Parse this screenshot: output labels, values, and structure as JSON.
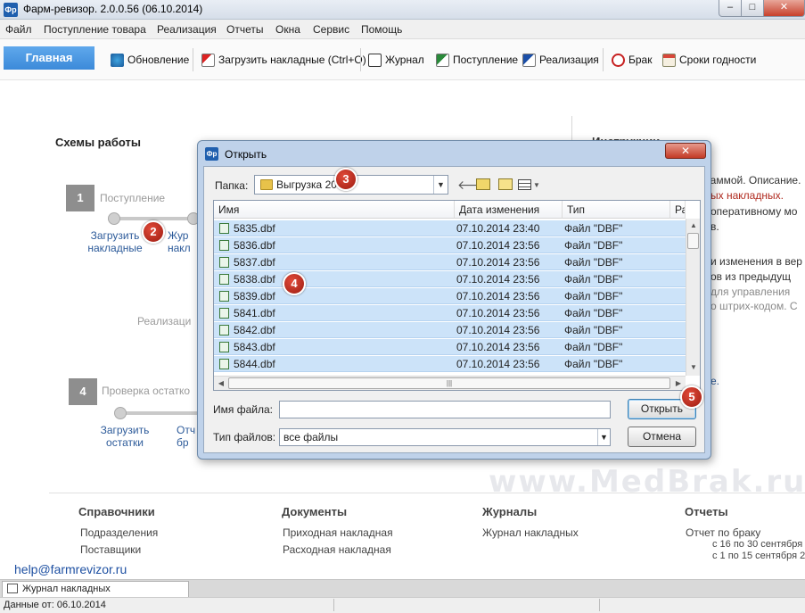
{
  "window": {
    "title": "Фарм-ревизор. 2.0.0.56 (06.10.2014)",
    "app_icon": "Фр",
    "min": "–",
    "max": "□",
    "close": "✕"
  },
  "menu": [
    "Файл",
    "Поступление товара",
    "Реализация",
    "Отчеты",
    "Окна",
    "Сервис",
    "Помощь"
  ],
  "toolbar": {
    "home": "Главная",
    "buttons": [
      "Обновление",
      "Загрузить накладные (Ctrl+O)",
      "Журнал",
      "Поступление",
      "Реализация",
      "Брак",
      "Сроки годности"
    ]
  },
  "schemes": {
    "title": "Схемы работы",
    "step1_num": "1",
    "step1_label": "Поступление",
    "step1_link1": "Загрузить\nнакладные",
    "step1_link2": "Жур\nнакл",
    "realization_label": "Реализаци",
    "step4_num": "4",
    "step4_label": "Проверка остатко",
    "step4_link1": "Загрузить\nостатки",
    "step4_link2": "Отч\nбр"
  },
  "instructions": {
    "title": "Инструкции",
    "line1": "раммой. Описание.",
    "line2": "ых накладных.",
    "line3": "оперативному мо",
    "line4": "в.",
    "line5": "и изменения в вер",
    "line6": "ов из предыдущ",
    "line7": "для управления",
    "line8": "о штрих-кодом. С",
    "line9": "е."
  },
  "sections": {
    "ref_title": "Справочники",
    "ref_links": [
      "Подразделения",
      "Поставщики"
    ],
    "doc_title": "Документы",
    "doc_links": [
      "Приходная накладная",
      "Расходная накладная"
    ],
    "jour_title": "Журналы",
    "jour_links": [
      "Журнал накладных"
    ],
    "rep_title": "Отчеты",
    "rep_links": [
      "Отчет по браку",
      "с 16 по 30 сентября",
      "с 1 по 15 сентября 2"
    ]
  },
  "footer": {
    "help_email": "help@farmrevizor.ru",
    "tab": "Журнал накладных",
    "status": "Данные от: 06.10.2014"
  },
  "watermark": "www.MedBrak.ru",
  "dialog": {
    "title": "Открыть",
    "icon": "Фр",
    "close": "✕",
    "folder_label": "Папка:",
    "folder_value": "Выгрузка 20",
    "columns": [
      "Имя",
      "Дата изменения",
      "Тип",
      "Ра"
    ],
    "files": [
      {
        "name": "5835.dbf",
        "date": "07.10.2014 23:40",
        "type": "Файл \"DBF\""
      },
      {
        "name": "5836.dbf",
        "date": "07.10.2014 23:56",
        "type": "Файл \"DBF\""
      },
      {
        "name": "5837.dbf",
        "date": "07.10.2014 23:56",
        "type": "Файл \"DBF\""
      },
      {
        "name": "5838.dbf",
        "date": "07.10.2014 23:56",
        "type": "Файл \"DBF\""
      },
      {
        "name": "5839.dbf",
        "date": "07.10.2014 23:56",
        "type": "Файл \"DBF\""
      },
      {
        "name": "5841.dbf",
        "date": "07.10.2014 23:56",
        "type": "Файл \"DBF\""
      },
      {
        "name": "5842.dbf",
        "date": "07.10.2014 23:56",
        "type": "Файл \"DBF\""
      },
      {
        "name": "5843.dbf",
        "date": "07.10.2014 23:56",
        "type": "Файл \"DBF\""
      },
      {
        "name": "5844.dbf",
        "date": "07.10.2014 23:56",
        "type": "Файл \"DBF\""
      }
    ],
    "filename_label": "Имя файла:",
    "filename_value": "",
    "filetype_label": "Тип файлов:",
    "filetype_value": "все файлы",
    "open_btn": "Открыть",
    "cancel_btn": "Отмена"
  },
  "markers": [
    "2",
    "3",
    "4",
    "5"
  ]
}
